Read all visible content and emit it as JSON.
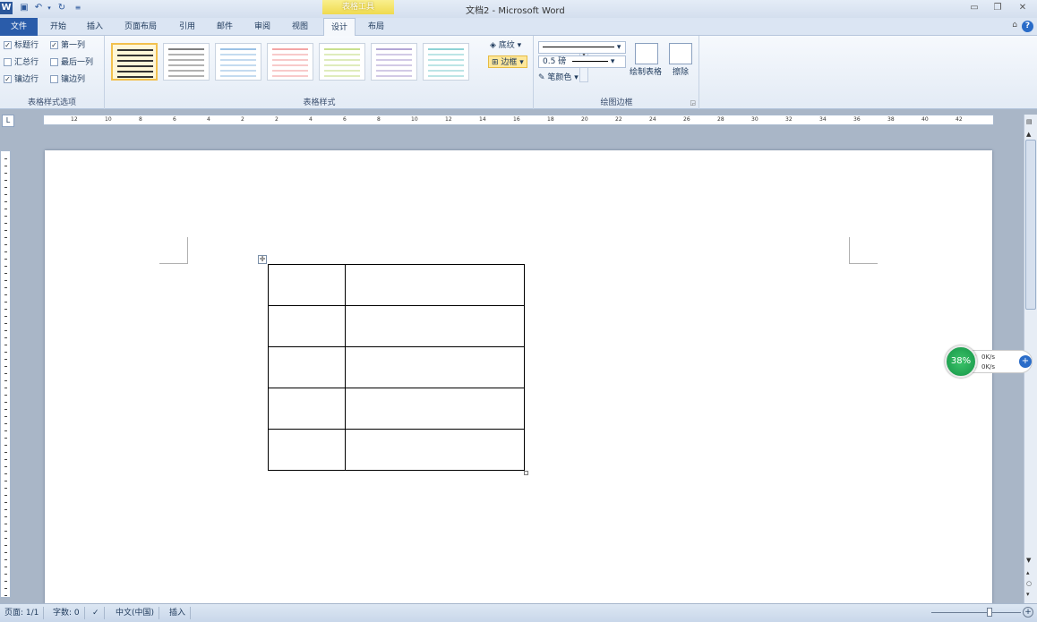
{
  "titlebar": {
    "title": "文档2 - Microsoft Word",
    "context_group": "表格工具",
    "logo_letter": "W"
  },
  "tabs": [
    {
      "label": "文件"
    },
    {
      "label": "开始"
    },
    {
      "label": "插入"
    },
    {
      "label": "页面布局"
    },
    {
      "label": "引用"
    },
    {
      "label": "邮件"
    },
    {
      "label": "审阅"
    },
    {
      "label": "视图"
    },
    {
      "label": "设计"
    },
    {
      "label": "布局"
    }
  ],
  "ribbon": {
    "style_options": {
      "label": "表格样式选项",
      "items": [
        {
          "label": "标题行",
          "checked": true
        },
        {
          "label": "第一列",
          "checked": true
        },
        {
          "label": "汇总行",
          "checked": false
        },
        {
          "label": "最后一列",
          "checked": false
        },
        {
          "label": "镶边行",
          "checked": true
        },
        {
          "label": "镶边列",
          "checked": false
        }
      ]
    },
    "table_styles": {
      "label": "表格样式",
      "thumb_colors": [
        "#333333",
        "#7f7f7f",
        "#9dc3e6",
        "#f4a6a6",
        "#c9e08f",
        "#b4a7d6",
        "#8fd3d6"
      ]
    },
    "shading_label": "底纹",
    "borders_label": "边框",
    "draw_borders": {
      "label": "绘图边框",
      "line_weight": "0.5 磅",
      "pen_color_label": "笔颜色",
      "draw_table_label": "绘制表格",
      "eraser_label": "擦除"
    }
  },
  "ruler": {
    "marks": [
      "12",
      "10",
      "8",
      "6",
      "4",
      "2",
      "2",
      "4",
      "6",
      "8",
      "10",
      "12",
      "14",
      "16",
      "18",
      "20",
      "22",
      "24",
      "26",
      "28",
      "30",
      "32",
      "34",
      "36",
      "38",
      "40",
      "42"
    ]
  },
  "table": {
    "rows": 5,
    "cols": 2
  },
  "net_widget": {
    "percent": "38%",
    "up": "0K/s",
    "down": "0K/s"
  },
  "statusbar": {
    "page": "页面: 1/1",
    "words": "字数: 0",
    "language": "中文(中国)",
    "mode": "插入"
  }
}
